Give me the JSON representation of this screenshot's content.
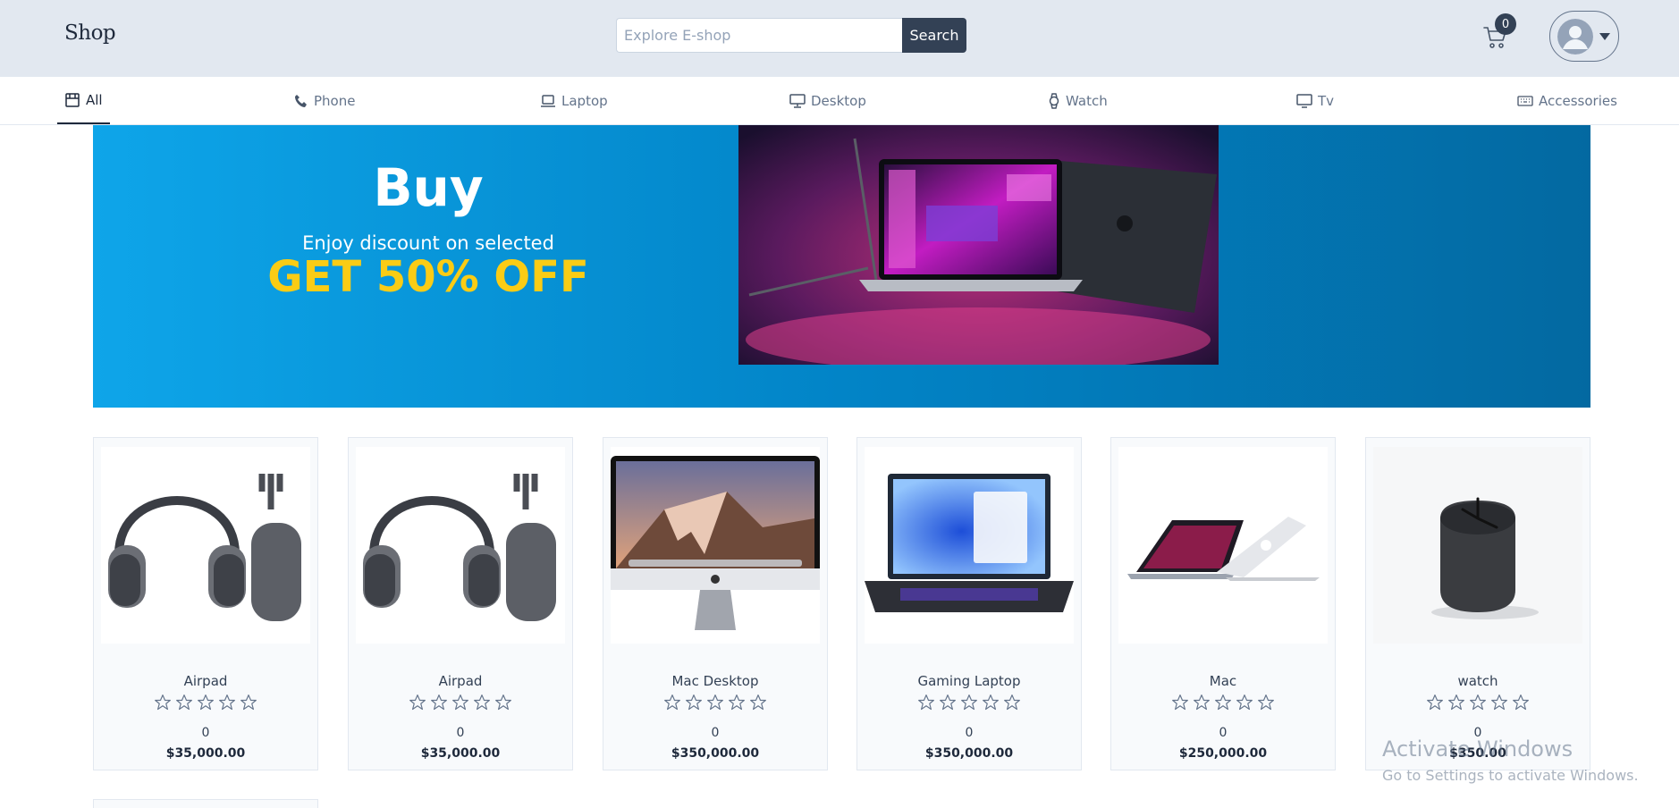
{
  "header": {
    "logo": "Shop",
    "search": {
      "placeholder": "Explore E-shop",
      "value": "",
      "button_label": "Search"
    },
    "cart": {
      "icon": "cart-icon",
      "count": "0"
    },
    "user_menu": {
      "icon": "user-avatar-icon",
      "caret": "caret-down-icon"
    }
  },
  "categories": [
    {
      "label": "All",
      "icon": "store-icon",
      "active": true
    },
    {
      "label": "Phone",
      "icon": "phone-icon"
    },
    {
      "label": "Laptop",
      "icon": "laptop-icon"
    },
    {
      "label": "Desktop",
      "icon": "desktop-icon"
    },
    {
      "label": "Watch",
      "icon": "watch-icon"
    },
    {
      "label": "Tv",
      "icon": "tv-icon"
    },
    {
      "label": "Accessories",
      "icon": "keyboard-icon"
    }
  ],
  "banner": {
    "title": "Buy",
    "subtitle": "Enjoy discount on selected",
    "offer": "GET 50% OFF",
    "image": "macbook-pro-laptops",
    "colors": {
      "bg_start": "#0ea5e9",
      "bg_end": "#0369a1",
      "offer": "#facc15"
    }
  },
  "products": [
    {
      "name": "Airpad",
      "rating": 0,
      "rating_max": 5,
      "reviews": "0",
      "price": "$35,000.00",
      "image": "headphones"
    },
    {
      "name": "Airpad",
      "rating": 0,
      "rating_max": 5,
      "reviews": "0",
      "price": "$35,000.00",
      "image": "headphones"
    },
    {
      "name": "Mac Desktop",
      "rating": 0,
      "rating_max": 5,
      "reviews": "0",
      "price": "$350,000.00",
      "image": "imac"
    },
    {
      "name": "Gaming Laptop",
      "rating": 0,
      "rating_max": 5,
      "reviews": "0",
      "price": "$350,000.00",
      "image": "laptop"
    },
    {
      "name": "Mac",
      "rating": 0,
      "rating_max": 5,
      "reviews": "0",
      "price": "$250,000.00",
      "image": "macbooks"
    },
    {
      "name": "watch",
      "rating": 0,
      "rating_max": 5,
      "reviews": "0",
      "price": "$350.00",
      "image": "desk-clock"
    }
  ],
  "watermark": {
    "title": "Activate Windows",
    "subtitle": "Go to Settings to activate Windows."
  }
}
